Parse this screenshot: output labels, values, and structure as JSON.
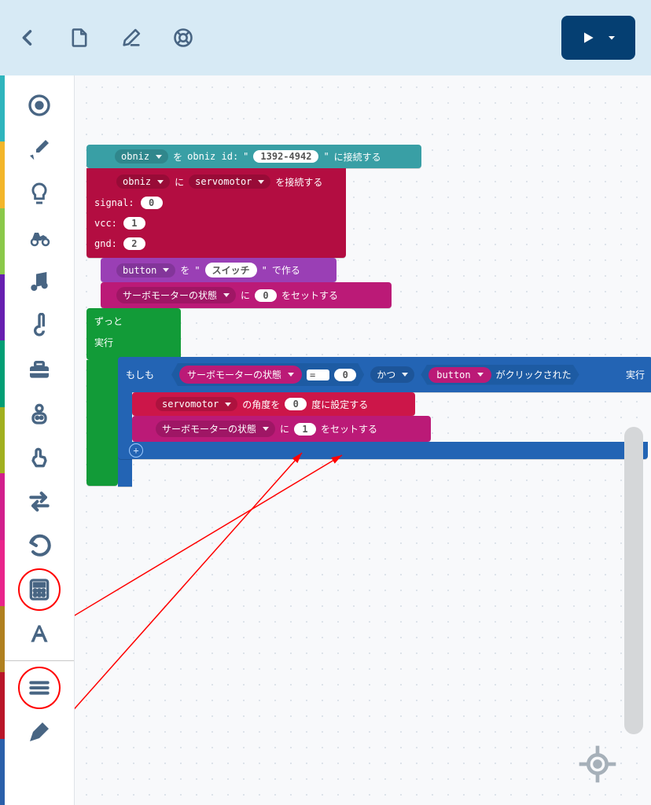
{
  "header": {
    "run_label": "Run"
  },
  "toolbox_colors": [
    "#2fb5bd",
    "#f3b62a",
    "#8ac849",
    "#671fb0",
    "#029e74",
    "#a1b01f",
    "#d21f8c",
    "#e9248b",
    "#b0801f",
    "#b91629",
    "#2a60aa"
  ],
  "blocks": {
    "connect": {
      "var": "obniz",
      "wo": "を",
      "id_label": "obniz id:",
      "id": "1392-4942",
      "tail": "に接続する"
    },
    "servo": {
      "var": "obniz",
      "ni": "に",
      "part": "servomotor",
      "tail": "を接続する",
      "pins": [
        {
          "k": "signal:",
          "v": "0"
        },
        {
          "k": "vcc:",
          "v": "1"
        },
        {
          "k": "gnd:",
          "v": "2"
        }
      ]
    },
    "button": {
      "var": "button",
      "wo": "を",
      "text": "スイッチ",
      "tail": "で作る"
    },
    "setvar": {
      "var": "サーボモーターの状態",
      "ni": "に",
      "val": "0",
      "tail": "をセットする"
    },
    "forever": {
      "lbl": "ずっと",
      "exec": "実行"
    },
    "if": {
      "if": "もしも",
      "var": "サーボモーターの状態",
      "op": "=",
      "cmp": "0",
      "and": "かつ",
      "btn": "button",
      "clicked": "がクリックされた",
      "exec": "実行"
    },
    "angle": {
      "var": "servomotor",
      "mid": "の角度を",
      "val": "0",
      "tail": "度に設定する"
    },
    "setvar2": {
      "var": "サーボモーターの状態",
      "ni": "に",
      "val": "1",
      "tail": "をセットする"
    }
  }
}
